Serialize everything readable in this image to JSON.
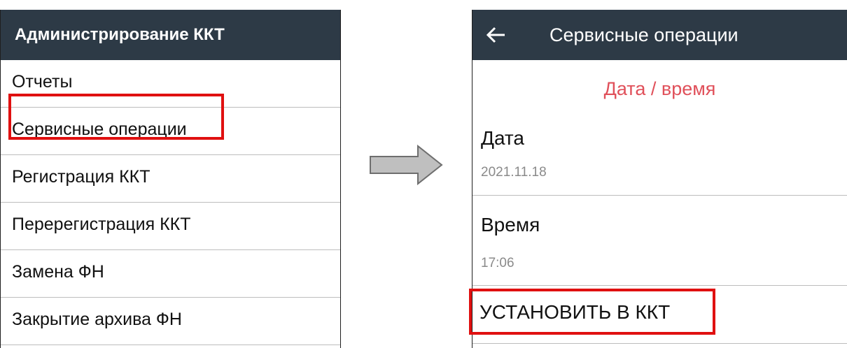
{
  "left_screen": {
    "title": "Администрирование ККТ",
    "menu_items": [
      "Отчеты",
      "Сервисные операции",
      "Регистрация ККТ",
      "Перерегистрация ККТ",
      "Замена ФН",
      "Закрытие архива ФН"
    ],
    "highlighted_item": "Сервисные операции"
  },
  "right_screen": {
    "title": "Сервисные операции",
    "back_icon": "arrow-left-icon",
    "section_header": "Дата / время",
    "fields": [
      {
        "label": "Дата",
        "value": "2021.11.18"
      },
      {
        "label": "Время",
        "value": "17:06"
      }
    ],
    "action_button": "УСТАНОВИТЬ В ККТ"
  },
  "transition_icon": "arrow-right-icon",
  "colors": {
    "appbar": "#2d3a46",
    "highlight": "#e01010",
    "section_header": "#e0505a",
    "arrow_fill": "#bfbfbf"
  }
}
